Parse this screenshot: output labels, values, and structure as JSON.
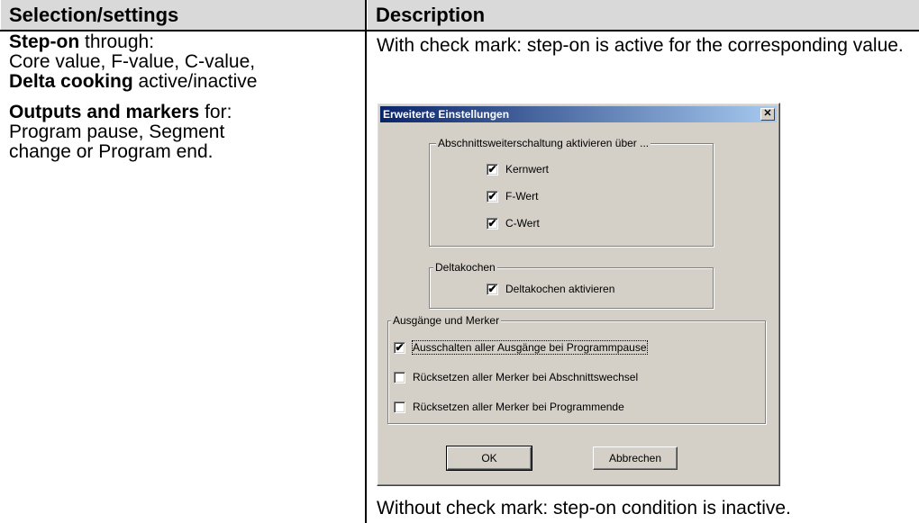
{
  "table": {
    "header_left": "Selection/settings",
    "header_right": "Description"
  },
  "left": {
    "p1_bold": "Step-on",
    "p1_rest": " through:",
    "p1_line2": "Core value, F-value, C-value,",
    "p1_line3_bold": "Delta cooking",
    "p1_line3_rest": " active/inactive",
    "p2_bold": "Outputs and markers",
    "p2_rest": " for:",
    "p2_line2": "Program pause, Segment",
    "p2_line3": "change or Program end."
  },
  "right": {
    "top_text": "With check mark: step-on is active for the corresponding value.",
    "bottom_text": "Without check mark: step-on condition is inactive."
  },
  "dialog": {
    "title": "Erweiterte Einstellungen",
    "close_glyph": "✕",
    "group1": {
      "label": "Abschnittsweiterschaltung aktivieren über ...",
      "items": [
        {
          "label": "Kernwert",
          "checked": true
        },
        {
          "label": "F-Wert",
          "checked": true
        },
        {
          "label": "C-Wert",
          "checked": true
        }
      ]
    },
    "group2": {
      "label": "Deltakochen",
      "items": [
        {
          "label": "Deltakochen aktivieren",
          "checked": true
        }
      ]
    },
    "group3": {
      "label": "Ausgänge und Merker",
      "items": [
        {
          "label": "Ausschalten aller Ausgänge bei Programmpause",
          "checked": true
        },
        {
          "label": "Rücksetzen aller Merker bei Abschnittswechsel",
          "checked": false
        },
        {
          "label": "Rücksetzen aller Merker bei Programmende",
          "checked": false
        }
      ]
    },
    "ok_label": "OK",
    "cancel_label": "Abbrechen",
    "check_glyph": "✔"
  }
}
